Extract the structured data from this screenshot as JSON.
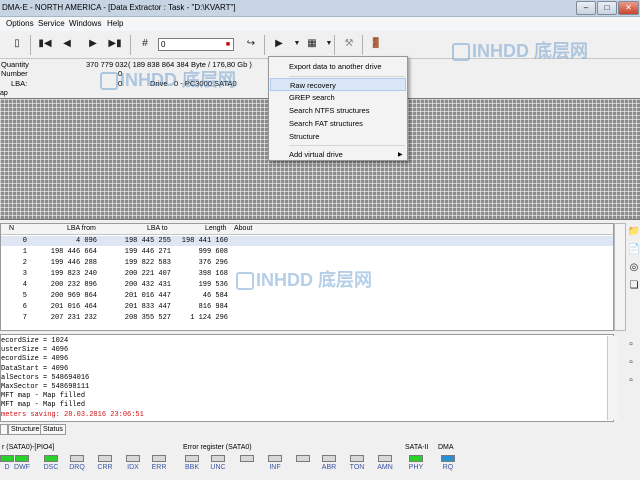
{
  "window": {
    "title": "DMA-E - NORTH AMERICA - [Data Extractor : Task - \"D:\\KVART\"]",
    "minimize": "–",
    "maximize": "□",
    "close": "✕"
  },
  "menu": [
    "Options",
    "Service",
    "Windows",
    "Help"
  ],
  "toolbar": {
    "lba_value": "0",
    "icons": [
      "first-icon",
      "prev-icon",
      "next-icon",
      "last-icon",
      "hash-icon",
      "goto-icon",
      "play-icon",
      "dropdown-arrow-icon",
      "grid-icon",
      "tools-icon",
      "exit-icon"
    ]
  },
  "info": {
    "quantity_label": "Quantity",
    "quantity_value": "370 779 032",
    "quantity_detail": "( 189 838 864 384 Byte / 176,80 Gb )",
    "number_label": "Number",
    "number_value": "0",
    "lba_label": "LBA:",
    "lba_value": "0",
    "drive_label": "Drive",
    "drive_value": "0 - PC3000 SATA0"
  },
  "map_label": "ap",
  "table": {
    "headers": [
      "N",
      "LBA from",
      "LBA to",
      "Length",
      "About"
    ],
    "rows": [
      [
        "0",
        "4 096",
        "198 445 255",
        "198 441 160",
        ""
      ],
      [
        "1",
        "198 446 664",
        "199 446 271",
        "999 608",
        ""
      ],
      [
        "2",
        "199 446 288",
        "199 822 583",
        "376 296",
        ""
      ],
      [
        "3",
        "199 823 240",
        "200 221 407",
        "398 168",
        ""
      ],
      [
        "4",
        "200 232 896",
        "200 432 431",
        "199 536",
        ""
      ],
      [
        "5",
        "200 969 864",
        "201 016 447",
        "46 584",
        ""
      ],
      [
        "6",
        "201 016 464",
        "201 833 447",
        "816 984",
        ""
      ],
      [
        "7",
        "207 231 232",
        "208 355 527",
        "1 124 296",
        ""
      ]
    ]
  },
  "log": [
    {
      "text": "ecordSize = 1024",
      "color": "#000000"
    },
    {
      "text": "usterSize = 4096",
      "color": "#000000"
    },
    {
      "text": "ecordSize = 4096",
      "color": "#000000"
    },
    {
      "text": "DataStart = 4096",
      "color": "#000000"
    },
    {
      "text": "alSectors = 548694016",
      "color": "#000000"
    },
    {
      "text": "MaxSector = 548698111",
      "color": "#000000"
    },
    {
      "text": " MFT map  - Map filled",
      "color": "#000000"
    },
    {
      "text": " MFT map  - Map filled",
      "color": "#000000"
    },
    {
      "text": "meters saving: 28.03.2016 23:06:51",
      "color": "#d01010"
    }
  ],
  "tabs": [
    "",
    "Structure",
    "Status"
  ],
  "status": {
    "group1": "r (SATA0)-[PIO4]",
    "group2": "Error register (SATA0)",
    "group3": "SATA-II",
    "group4": "DMA",
    "leds1": [
      "D",
      "DWF",
      "DSC",
      "DRQ",
      "CRR",
      "IDX",
      "ERR"
    ],
    "leds2": [
      "BBK",
      "UNC",
      "",
      "INF",
      "",
      "ABR",
      "TON",
      "AMN"
    ],
    "leds3": [
      "PHY"
    ],
    "leds4": [
      "RQ"
    ]
  },
  "dropdown": {
    "items": [
      "Export data to another drive",
      "Raw recovery",
      "GREP search",
      "Search NTFS structures",
      "Search FAT structures",
      "Structure",
      "Add virtual drive"
    ],
    "submenu_arrow": "▶"
  },
  "watermark": {
    "latin": "INHDD",
    "cjk": "底层网"
  },
  "colors": {
    "led_on": "#2bd12b",
    "log_highlight": "#d01010",
    "selection": "#dde6f2"
  }
}
